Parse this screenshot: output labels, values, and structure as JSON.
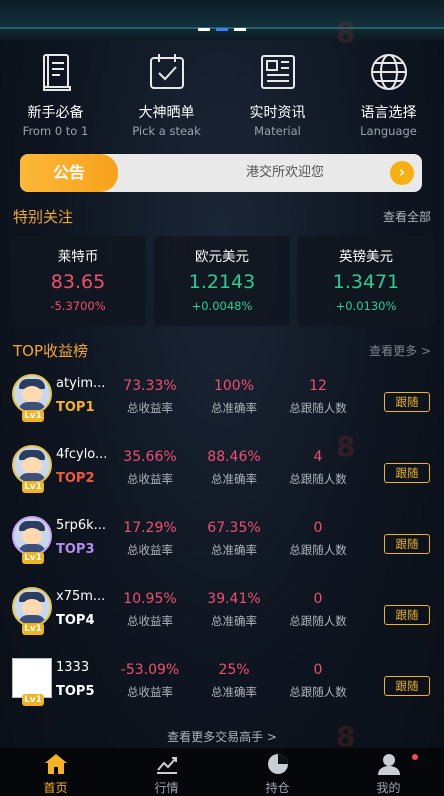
{
  "nav": [
    {
      "title": "新手必备",
      "subtitle": "From 0 to 1",
      "icon": "book-icon"
    },
    {
      "title": "大神晒单",
      "subtitle": "Pick a steak",
      "icon": "clipboard-check-icon"
    },
    {
      "title": "实时资讯",
      "subtitle": "Material",
      "icon": "news-icon"
    },
    {
      "title": "语言选择",
      "subtitle": "Language",
      "icon": "globe-icon"
    }
  ],
  "notice": {
    "tag": "公告",
    "text": "港交所欢迎您",
    "arrow": "›"
  },
  "watch": {
    "title": "特别关注",
    "more": "查看全部",
    "items": [
      {
        "name": "莱特币",
        "price": "83.65",
        "change": "-5.3700%",
        "trend": "down"
      },
      {
        "name": "欧元美元",
        "price": "1.2143",
        "change": "+0.0048%",
        "trend": "up"
      },
      {
        "name": "英镑美元",
        "price": "1.3471",
        "change": "+0.0130%",
        "trend": "up"
      }
    ]
  },
  "ranking": {
    "title": "TOP收益榜",
    "more": "查看更多 >",
    "label_rate": "总收益率",
    "label_acc": "总准确率",
    "label_followers": "总跟随人数",
    "follow_label": "跟随",
    "level": "Lv1",
    "rows": [
      {
        "name": "atyim...",
        "rank": "TOP1",
        "rate": "73.33%",
        "accuracy": "100%",
        "followers": "12"
      },
      {
        "name": "4fcylo...",
        "rank": "TOP2",
        "rate": "35.66%",
        "accuracy": "88.46%",
        "followers": "4"
      },
      {
        "name": "5rp6k...",
        "rank": "TOP3",
        "rate": "17.29%",
        "accuracy": "67.35%",
        "followers": "0"
      },
      {
        "name": "x75m...",
        "rank": "TOP4",
        "rate": "10.95%",
        "accuracy": "39.41%",
        "followers": "0"
      },
      {
        "name": "1333",
        "rank": "TOP5",
        "rate": "-53.09%",
        "accuracy": "25%",
        "followers": "0"
      }
    ],
    "more_traders": "查看更多交易高手  >"
  },
  "tabs": [
    {
      "label": "首页",
      "icon": "home-icon",
      "active": true
    },
    {
      "label": "行情",
      "icon": "chart-icon",
      "active": false
    },
    {
      "label": "持仓",
      "icon": "pie-icon",
      "active": false
    },
    {
      "label": "我的",
      "icon": "user-icon",
      "active": false
    }
  ],
  "colors": {
    "accent": "#f4b425",
    "down": "#f0506e",
    "up": "#2dcc8f",
    "rank1": "#f4b425",
    "rank2": "#f05a3a",
    "rank3": "#b58cf0",
    "rank4": "#ffffff",
    "rank5": "#ffffff"
  }
}
